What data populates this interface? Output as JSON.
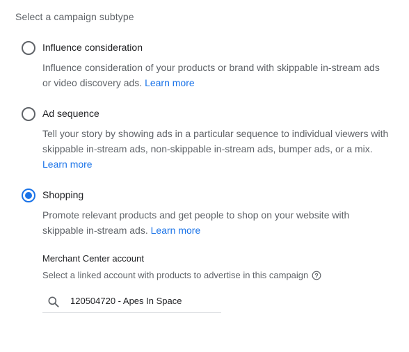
{
  "header": {
    "title": "Select a campaign subtype"
  },
  "options": [
    {
      "label": "Influence consideration",
      "desc_lines": [
        "Influence consideration of your products or brand with skippable in-stream ads",
        "or video discovery ads."
      ],
      "learn_more": "Learn more",
      "selected": false
    },
    {
      "label": "Ad sequence",
      "desc_lines": [
        "Tell your story by showing ads in a particular sequence to individual viewers with",
        "skippable in-stream ads, non-skippable in-stream ads, bumper ads, or a mix."
      ],
      "learn_more": "Learn more",
      "selected": false
    },
    {
      "label": "Shopping",
      "desc_lines": [
        "Promote relevant products and get people to shop on your website with",
        "skippable in-stream ads."
      ],
      "learn_more": "Learn more",
      "selected": true
    }
  ],
  "merchant": {
    "title": "Merchant Center account",
    "help_text": "Select a linked account with products to advertise in this campaign",
    "help_icon": "help-circle-icon",
    "search_icon": "search-icon",
    "search_value": "120504720 - Apes In Space"
  },
  "colors": {
    "accent": "#1a73e8",
    "secondary_text": "#5f6368",
    "primary_text": "#202124",
    "divider": "#dadce0"
  }
}
